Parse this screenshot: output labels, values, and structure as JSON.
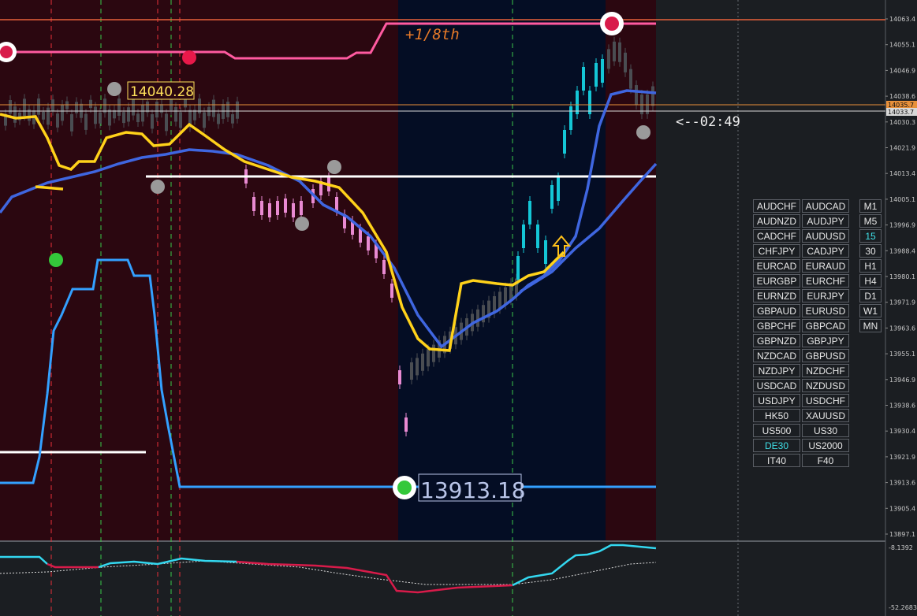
{
  "colors": {
    "bg": "#1b1e22",
    "zone_red": "#2b0710",
    "zone_blue": "#040d24",
    "bull_candle": "#14c6d6",
    "bear_candle": "#e98ad2",
    "neutral_candle": "#4a4d52",
    "yellow_ma": "#ffd21a",
    "blue_ma": "#3f66e0",
    "pink_line": "#ff5aa0",
    "cyan_line": "#33a0ff",
    "osc_up": "#33d8f0",
    "osc_down": "#d81b4a"
  },
  "price_axis": {
    "ticks": [
      "14063.4",
      "14055.1",
      "14046.9",
      "14038.6",
      "14030.3",
      "14021.9",
      "14013.4",
      "14005.1",
      "13996.9",
      "13988.4",
      "13980.1",
      "13971.9",
      "13963.6",
      "13955.1",
      "13946.9",
      "13938.6",
      "13930.4",
      "13921.9",
      "13913.6",
      "13905.4",
      "13897.1"
    ],
    "ask_label": "14035.7",
    "bid_label": "14033.7",
    "osc_top": "-8.1392",
    "osc_bottom": "-52.2683"
  },
  "annotations": {
    "eighth_label": "+1/8th",
    "high_label": "14040.28",
    "low_label": "13913.18",
    "countdown": "<--02:49"
  },
  "symbols": {
    "left": [
      "AUDCHF",
      "AUDNZD",
      "CADCHF",
      "CHFJPY",
      "EURCAD",
      "EURGBP",
      "EURNZD",
      "GBPAUD",
      "GBPCHF",
      "GBPNZD",
      "NZDCAD",
      "NZDJPY",
      "USDCAD",
      "USDJPY",
      "HK50",
      "US500",
      "DE30",
      "IT40"
    ],
    "right": [
      "AUDCAD",
      "AUDJPY",
      "AUDUSD",
      "CADJPY",
      "EURAUD",
      "EURCHF",
      "EURJPY",
      "EURUSD",
      "GBPCAD",
      "GBPJPY",
      "GBPUSD",
      "NZDCHF",
      "NZDUSD",
      "USDCHF",
      "XAUUSD",
      "US30",
      "US2000",
      "F40"
    ],
    "active": "DE30"
  },
  "timeframes": {
    "items": [
      "M1",
      "M5",
      "15",
      "30",
      "H1",
      "H4",
      "D1",
      "W1",
      "MN"
    ],
    "active": "15"
  }
}
